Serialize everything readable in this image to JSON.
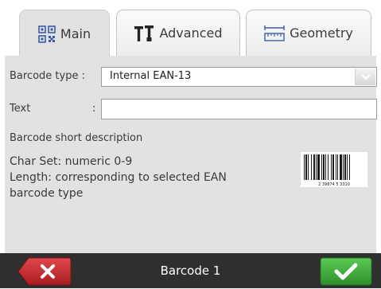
{
  "tabs": [
    {
      "label": "Main",
      "icon": "qr-code-icon",
      "active": true
    },
    {
      "label": "Advanced",
      "icon": "tools-icon",
      "active": false
    },
    {
      "label": "Geometry",
      "icon": "ruler-icon",
      "active": false
    }
  ],
  "form": {
    "barcode_type_label": "Barcode type :",
    "barcode_type_value": "Internal EAN-13",
    "text_label": "Text",
    "text_colon": ":",
    "text_value": ""
  },
  "description": {
    "heading": "Barcode short description",
    "line1": "Char Set: numeric 0-9",
    "line2": "Length: corresponding to selected EAN",
    "line3": "barcode type"
  },
  "preview": {
    "icon": "barcode-preview-icon",
    "digits": "2 39874 5 3310"
  },
  "footer": {
    "title": "Barcode 1",
    "cancel_icon": "close-icon",
    "ok_icon": "checkmark-icon"
  },
  "colors": {
    "panel": "#e2e2e2",
    "footer": "#2f2f2f",
    "cancel": "#c0272d",
    "ok": "#3aa53a"
  }
}
